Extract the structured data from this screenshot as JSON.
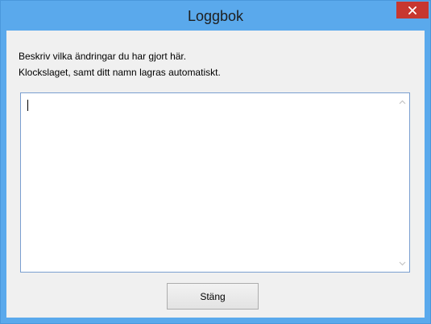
{
  "window": {
    "title": "Loggbok",
    "accent_color": "#5aa9ec",
    "close_button_color": "#c7372f"
  },
  "description": {
    "line1": "Beskriv vilka ändringar du har gjort här.",
    "line2": "Klockslaget, samt ditt namn lagras automatiskt."
  },
  "log_entry": {
    "value": ""
  },
  "footer": {
    "close_label": "Stäng"
  },
  "icons": {
    "close": "close-icon",
    "scroll_up": "chevron-up-icon",
    "scroll_down": "chevron-down-icon"
  }
}
